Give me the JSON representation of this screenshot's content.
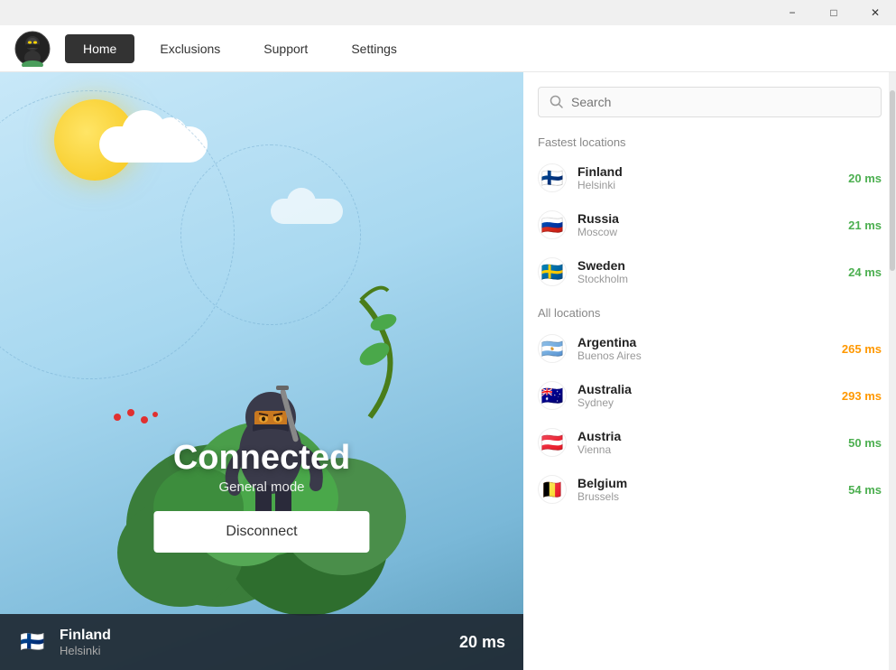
{
  "titleBar": {
    "minimizeLabel": "−",
    "maximizeLabel": "□",
    "closeLabel": "✕"
  },
  "nav": {
    "items": [
      {
        "id": "home",
        "label": "Home",
        "active": true
      },
      {
        "id": "exclusions",
        "label": "Exclusions",
        "active": false
      },
      {
        "id": "support",
        "label": "Support",
        "active": false
      },
      {
        "id": "settings",
        "label": "Settings",
        "active": false
      }
    ]
  },
  "hero": {
    "status": "Connected",
    "mode": "General mode",
    "disconnectLabel": "Disconnect"
  },
  "statusBar": {
    "country": "Finland",
    "city": "Helsinki",
    "ping": "20 ms",
    "flag": "🇫🇮"
  },
  "search": {
    "placeholder": "Search"
  },
  "fastestLocations": {
    "sectionLabel": "Fastest locations",
    "items": [
      {
        "id": "fi",
        "country": "Finland",
        "city": "Helsinki",
        "ping": "20 ms",
        "pingClass": "fast",
        "flag": "🇫🇮"
      },
      {
        "id": "ru",
        "country": "Russia",
        "city": "Moscow",
        "ping": "21 ms",
        "pingClass": "fast",
        "flag": "🇷🇺"
      },
      {
        "id": "se",
        "country": "Sweden",
        "city": "Stockholm",
        "ping": "24 ms",
        "pingClass": "fast",
        "flag": "🇸🇪"
      }
    ]
  },
  "allLocations": {
    "sectionLabel": "All locations",
    "items": [
      {
        "id": "ar",
        "country": "Argentina",
        "city": "Buenos Aires",
        "ping": "265 ms",
        "pingClass": "medium",
        "flag": "🇦🇷"
      },
      {
        "id": "au",
        "country": "Australia",
        "city": "Sydney",
        "ping": "293 ms",
        "pingClass": "medium",
        "flag": "🇦🇺"
      },
      {
        "id": "at",
        "country": "Austria",
        "city": "Vienna",
        "ping": "50 ms",
        "pingClass": "fast",
        "flag": "🇦🇹"
      },
      {
        "id": "be",
        "country": "Belgium",
        "city": "Brussels",
        "ping": "54 ms",
        "pingClass": "fast",
        "flag": "🇧🇪"
      }
    ]
  }
}
